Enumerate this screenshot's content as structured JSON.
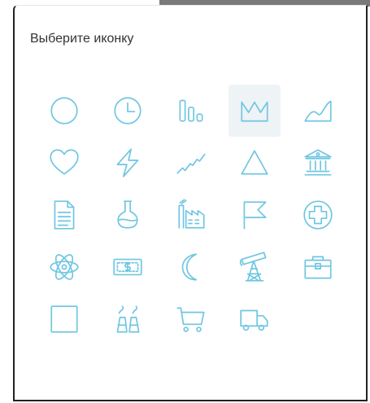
{
  "popup": {
    "title": "Выберите иконку",
    "selected_icon": "crown-icon"
  },
  "icons": [
    "circle-icon",
    "clock-icon",
    "bar-chart-icon",
    "crown-icon",
    "area-chart-icon",
    "heart-icon",
    "lightning-icon",
    "line-chart-icon",
    "triangle-icon",
    "bank-icon",
    "document-icon",
    "flask-icon",
    "factory-icon",
    "flag-icon",
    "medical-plus-icon",
    "atom-icon",
    "banknote-icon",
    "moon-icon",
    "oil-pump-icon",
    "toolbox-icon",
    "square-icon",
    "power-plant-icon",
    "shopping-cart-icon",
    "delivery-truck-icon"
  ],
  "colors": {
    "icon_stroke": "#6fc6e2",
    "selected_bg": "#eef3f6",
    "title_text": "#333333",
    "backdrop_bar": "#7a7a7a"
  }
}
